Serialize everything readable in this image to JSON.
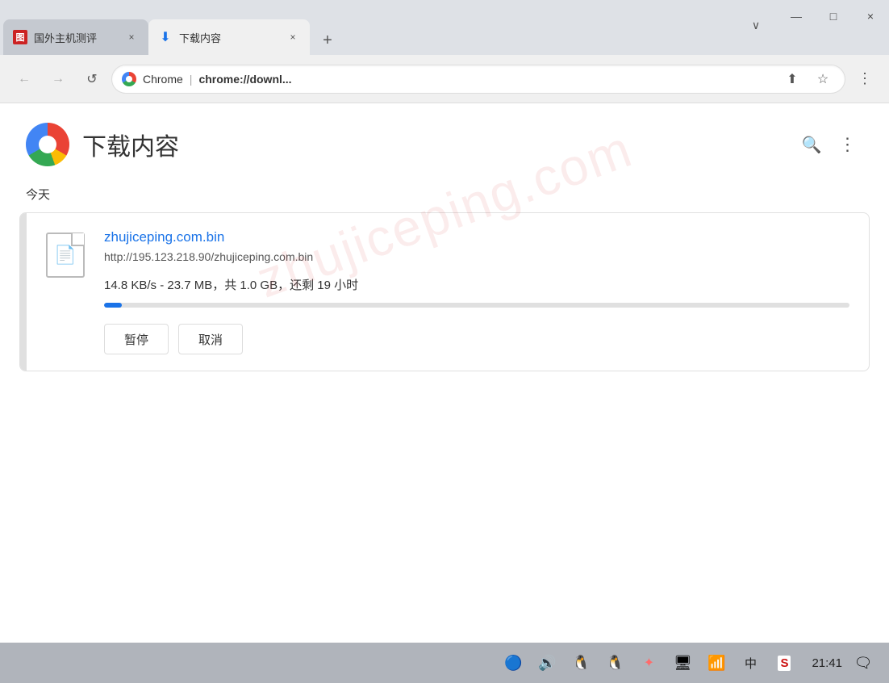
{
  "titlebar": {
    "tab_inactive_label": "国外主机测评",
    "tab_active_label": "下载内容",
    "tab_close_symbol": "×",
    "new_tab_symbol": "+",
    "overflow_symbol": "∨",
    "btn_minimize": "—",
    "btn_restore": "□",
    "btn_close": "×"
  },
  "navbar": {
    "back_symbol": "←",
    "forward_symbol": "→",
    "reload_symbol": "↺",
    "site_name": "Chrome",
    "url_prefix": "chrome://",
    "url_suffix": "downl...",
    "share_symbol": "⬆",
    "bookmark_symbol": "☆",
    "more_symbol": "⋮"
  },
  "page": {
    "title": "下载内容",
    "search_symbol": "🔍",
    "more_symbol": "⋮",
    "watermark": "zhujiceping.com",
    "today_label": "今天"
  },
  "download": {
    "filename": "zhujiceping.com.bin",
    "url": "http://195.123.218.90/zhujiceping.com.bin",
    "status": "14.8 KB/s - 23.7 MB，共 1.0 GB，还剩 19 小时",
    "progress_percent": 2.4,
    "pause_label": "暂停",
    "cancel_label": "取消"
  },
  "taskbar": {
    "bluetooth_icon": "🔵",
    "volume_icon": "🔊",
    "qq1_icon": "🐧",
    "qq2_icon": "🐧",
    "figma_icon": "✦",
    "screen_icon": "🖥",
    "wifi_icon": "📶",
    "lang_icon": "中",
    "ime_icon": "S",
    "time": "21:41",
    "notification_icon": "🗨"
  },
  "colors": {
    "accent_blue": "#1a73e8",
    "progress_bg": "#e0e0e0",
    "tab_active_bg": "#f0f0f0",
    "tab_inactive_bg": "#c5c9d0",
    "taskbar_bg": "#b0b4bb"
  }
}
